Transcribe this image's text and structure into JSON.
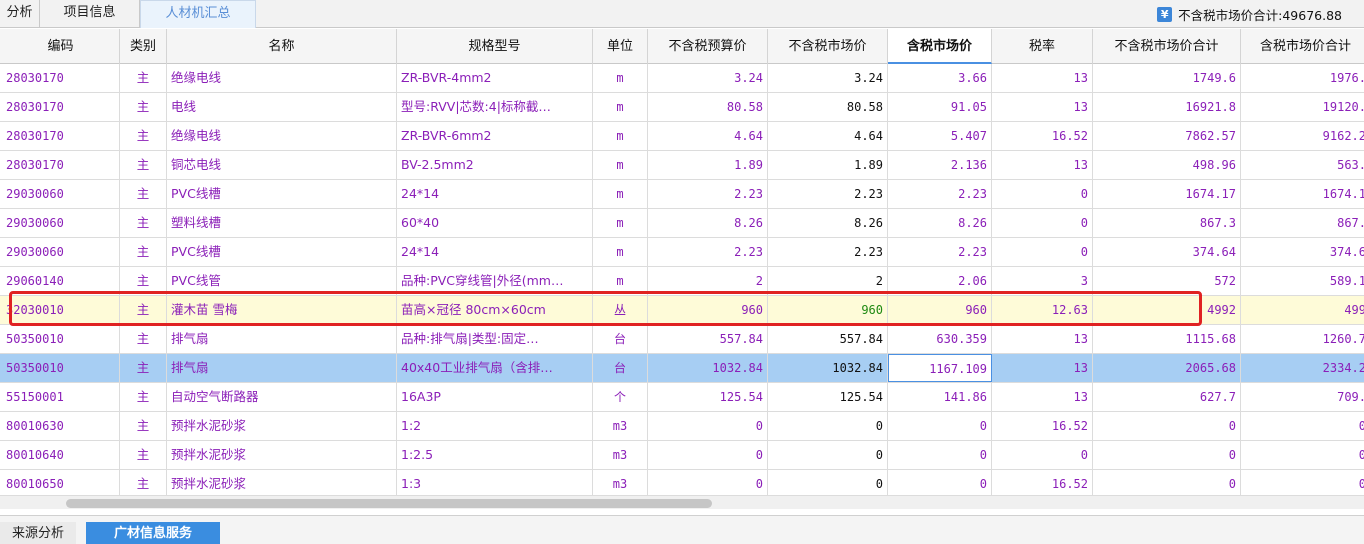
{
  "top_tabs": [
    {
      "label": "分析",
      "active": false
    },
    {
      "label": "项目信息",
      "active": false
    },
    {
      "label": "人材机汇总",
      "active": true
    }
  ],
  "summary": {
    "icon": "yen-icon",
    "icon_glyph": "¥",
    "label": "不含税市场价合计:49676.88"
  },
  "columns": [
    "编码",
    "类别",
    "名称",
    "规格型号",
    "单位",
    "不含税预算价",
    "不含税市场价",
    "含税市场价",
    "税率",
    "不含税市场价合计",
    "含税市场价合计"
  ],
  "rows": [
    {
      "code": "28030170",
      "type": "主",
      "name": "绝缘电线",
      "spec": "ZR-BVR-4mm2",
      "unit": "m",
      "budget": "3.24",
      "market": "3.24",
      "market_tax": "3.66",
      "rate": "13",
      "total": "1749.6",
      "total_tax": "1976."
    },
    {
      "code": "28030170",
      "type": "主",
      "name": "电线",
      "spec": "型号:RVV|芯数:4|标称截…",
      "unit": "m",
      "budget": "80.58",
      "market": "80.58",
      "market_tax": "91.05",
      "rate": "13",
      "total": "16921.8",
      "total_tax": "19120."
    },
    {
      "code": "28030170",
      "type": "主",
      "name": "绝缘电线",
      "spec": "ZR-BVR-6mm2",
      "unit": "m",
      "budget": "4.64",
      "market": "4.64",
      "market_tax": "5.407",
      "rate": "16.52",
      "total": "7862.57",
      "total_tax": "9162.2"
    },
    {
      "code": "28030170",
      "type": "主",
      "name": "铜芯电线",
      "spec": "BV-2.5mm2",
      "unit": "m",
      "budget": "1.89",
      "market": "1.89",
      "market_tax": "2.136",
      "rate": "13",
      "total": "498.96",
      "total_tax": "563."
    },
    {
      "code": "29030060",
      "type": "主",
      "name": " PVC线槽",
      "spec": "24*14",
      "unit": "m",
      "budget": "2.23",
      "market": "2.23",
      "market_tax": "2.23",
      "rate": "0",
      "total": "1674.17",
      "total_tax": "1674.1"
    },
    {
      "code": "29030060",
      "type": "主",
      "name": "塑料线槽",
      "spec": "60*40",
      "unit": "m",
      "budget": "8.26",
      "market": "8.26",
      "market_tax": "8.26",
      "rate": "0",
      "total": "867.3",
      "total_tax": "867."
    },
    {
      "code": "29030060",
      "type": "主",
      "name": "PVC线槽",
      "spec": "24*14",
      "unit": "m",
      "budget": "2.23",
      "market": "2.23",
      "market_tax": "2.23",
      "rate": "0",
      "total": "374.64",
      "total_tax": "374.6"
    },
    {
      "code": "29060140",
      "type": "主",
      "name": "PVC线管",
      "spec": "品种:PVC穿线管|外径(mm…",
      "unit": "m",
      "budget": "2",
      "market": "2",
      "market_tax": "2.06",
      "rate": "3",
      "total": "572",
      "total_tax": "589.1"
    },
    {
      "code": "32030010",
      "type": "主",
      "name": "灌木苗 雪梅",
      "spec": "苗高×冠径 80cm×60cm",
      "unit": "丛",
      "budget": "960",
      "market": "960",
      "market_tax": "960",
      "rate": "12.63",
      "total": "4992",
      "total_tax": "499"
    },
    {
      "code": "50350010",
      "type": "主",
      "name": "排气扇",
      "spec": "品种:排气扇|类型:固定…",
      "unit": "台",
      "budget": "557.84",
      "market": "557.84",
      "market_tax": "630.359",
      "rate": "13",
      "total": "1115.68",
      "total_tax": "1260.7"
    },
    {
      "code": "50350010",
      "type": "主",
      "name": "排气扇",
      "spec": "40x40工业排气扇（含排…",
      "unit": "台",
      "budget": "1032.84",
      "market": "1032.84",
      "market_tax": "1167.109",
      "rate": "13",
      "total": "2065.68",
      "total_tax": "2334.2"
    },
    {
      "code": "55150001",
      "type": "主",
      "name": "自动空气断路器",
      "spec": "16A3P",
      "unit": "个",
      "budget": "125.54",
      "market": "125.54",
      "market_tax": "141.86",
      "rate": "13",
      "total": "627.7",
      "total_tax": "709."
    },
    {
      "code": "80010630",
      "type": "主",
      "name": "预拌水泥砂浆",
      "spec": "1:2",
      "unit": "m3",
      "budget": "0",
      "market": "0",
      "market_tax": "0",
      "rate": "16.52",
      "total": "0",
      "total_tax": "0"
    },
    {
      "code": "80010640",
      "type": "主",
      "name": "预拌水泥砂浆",
      "spec": "1:2.5",
      "unit": "m3",
      "budget": "0",
      "market": "0",
      "market_tax": "0",
      "rate": "0",
      "total": "0",
      "total_tax": "0"
    },
    {
      "code": "80010650",
      "type": "主",
      "name": "预拌水泥砂浆",
      "spec": "1:3",
      "unit": "m3",
      "budget": "0",
      "market": "0",
      "market_tax": "0",
      "rate": "16.52",
      "total": "0",
      "total_tax": "0"
    }
  ],
  "highlighted_row": 8,
  "selected_row": 10,
  "bottom_tabs": [
    {
      "label": "来源分析",
      "active": false
    },
    {
      "label": "广材信息服务",
      "active": true
    }
  ],
  "colors": {
    "purple_text": "#8b1fb8",
    "accent_blue": "#3a8de0",
    "highlight_row": "#fefbd8",
    "selected_row": "#a7cef3",
    "red_outline": "#e02222",
    "green_value": "#1f8a12"
  }
}
